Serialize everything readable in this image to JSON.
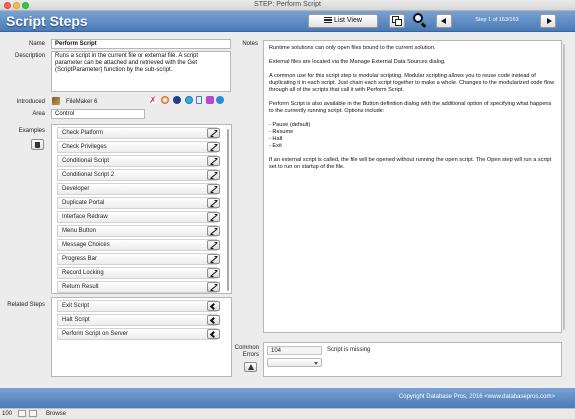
{
  "window": {
    "title": "STEP: Perform Script"
  },
  "header": {
    "app_title": "Script Steps",
    "list_view_label": "List View",
    "step_count": "Step 1 of 163/163"
  },
  "fields": {
    "name_label": "Name",
    "name_value": "Perform Script",
    "description_label": "Description",
    "description_value": "Runs a script in the current file or external file. A script parameter can be attached and retrieved with the Get (ScriptParameter) function by the sub-script.",
    "introduced_label": "Introduced",
    "introduced_value": "FileMaker 6",
    "area_label": "Area",
    "area_value": "Control",
    "notes_label": "Notes"
  },
  "examples": {
    "label": "Examples",
    "items": [
      "Check Platform",
      "Check Privileges",
      "Conditional Script",
      "Conditional Script 2",
      "Developer",
      "Duplicate Portal",
      "Interface Redraw",
      "Menu Button",
      "Message Choices",
      "Progress Bar",
      "Record Locking",
      "Return Result"
    ]
  },
  "related": {
    "label": "Related Steps",
    "items": [
      "Exit Script",
      "Halt Script",
      "Perform Script on Server"
    ]
  },
  "notes": {
    "paragraphs": [
      "Runtime solutions can only open files bound to the current solution.",
      "External files are located via the Manage External Data Sources dialog.",
      "A common use for this script step is modular scripting. Modular scripting allows you to reuse code instead of duplicating it in each script. Just chain each script together to make a whole. Changes to the modularized code flow through all of the scripts that call it with Perform Script.",
      "Perform Script is also available in the Button definition dialog with the additional option of specifying what happens to the currently running script. Options include:",
      "- Pause (default)\n- Resume\n- Halt\n- Exit",
      "If an external script is called, the file will be opened without running the open script. The Open step will run a script set to run on startup of the file."
    ]
  },
  "errors": {
    "label": "Common Errors",
    "code": "104",
    "description": "Script is missing"
  },
  "footer": {
    "copyright": "Copyright Database Pros, 2016 <www.databasepros.com>"
  },
  "statusbar": {
    "zoom": "100",
    "mode": "Browse"
  }
}
